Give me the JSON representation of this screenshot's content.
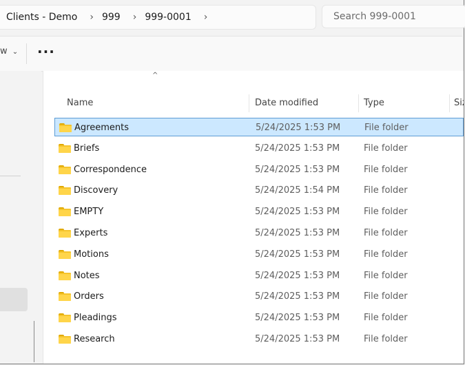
{
  "address_bar": {
    "crumbs": [
      "Clients - Demo",
      "999",
      "999-0001"
    ]
  },
  "search": {
    "placeholder": "Search 999-0001"
  },
  "toolbar": {
    "view_label": "w",
    "view_chevron": "⌄",
    "more_label": "···"
  },
  "columns": {
    "name": "Name",
    "date": "Date modified",
    "type": "Type",
    "size": "Siz"
  },
  "files": [
    {
      "name": "Agreements",
      "date": "5/24/2025 1:53 PM",
      "type": "File folder",
      "selected": true
    },
    {
      "name": "Briefs",
      "date": "5/24/2025 1:53 PM",
      "type": "File folder"
    },
    {
      "name": "Correspondence",
      "date": "5/24/2025 1:53 PM",
      "type": "File folder"
    },
    {
      "name": "Discovery",
      "date": "5/24/2025 1:54 PM",
      "type": "File folder"
    },
    {
      "name": "EMPTY",
      "date": "5/24/2025 1:53 PM",
      "type": "File folder"
    },
    {
      "name": "Experts",
      "date": "5/24/2025 1:53 PM",
      "type": "File folder"
    },
    {
      "name": "Motions",
      "date": "5/24/2025 1:53 PM",
      "type": "File folder"
    },
    {
      "name": "Notes",
      "date": "5/24/2025 1:53 PM",
      "type": "File folder"
    },
    {
      "name": "Orders",
      "date": "5/24/2025 1:53 PM",
      "type": "File folder"
    },
    {
      "name": "Pleadings",
      "date": "5/24/2025 1:53 PM",
      "type": "File folder"
    },
    {
      "name": "Research",
      "date": "5/24/2025 1:53 PM",
      "type": "File folder"
    }
  ],
  "colors": {
    "selection_bg": "#cce8ff",
    "selection_border": "#5c9bd3",
    "folder": "#f5c42c"
  }
}
